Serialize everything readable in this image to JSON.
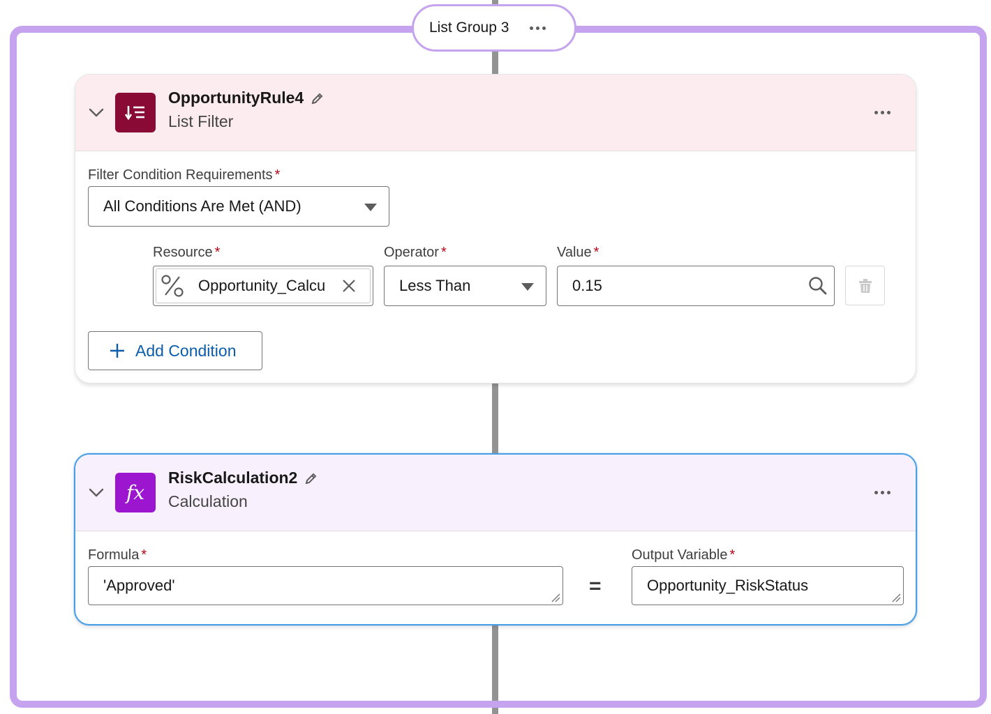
{
  "group": {
    "title": "List Group 3"
  },
  "filter_card": {
    "title": "OpportunityRule4",
    "subtitle": "List Filter",
    "requirements_label": "Filter Condition Requirements",
    "requirements_value": "All Conditions Are Met (AND)",
    "condition": {
      "resource_label": "Resource",
      "resource_value": "Opportunity_Calcu",
      "operator_label": "Operator",
      "operator_value": "Less Than",
      "value_label": "Value",
      "value_value": "0.15"
    },
    "add_condition_label": "Add Condition"
  },
  "calc_card": {
    "title": "RiskCalculation2",
    "subtitle": "Calculation",
    "formula_label": "Formula",
    "formula_value": "'Approved'",
    "equals": "=",
    "output_label": "Output Variable",
    "output_value": "Opportunity_RiskStatus"
  },
  "required_marker": "*",
  "colors": {
    "group_border": "#c5a3ee",
    "filter_header": "#fcebef",
    "filter_icon": "#8a0a36",
    "calc_header": "#f9f0fd",
    "calc_icon": "#9b16ce",
    "selected_border": "#4aa0e6",
    "link": "#0b5cab",
    "required": "#ba0517"
  },
  "icons": {
    "filter": "list-filter-icon",
    "calc": "fx-icon",
    "edit": "pencil-icon",
    "collapse": "chevron-down-icon",
    "more": "more-dots-icon",
    "resource_type": "percent-icon",
    "clear": "close-icon",
    "search": "search-icon",
    "delete": "trash-icon",
    "add": "plus-icon"
  }
}
